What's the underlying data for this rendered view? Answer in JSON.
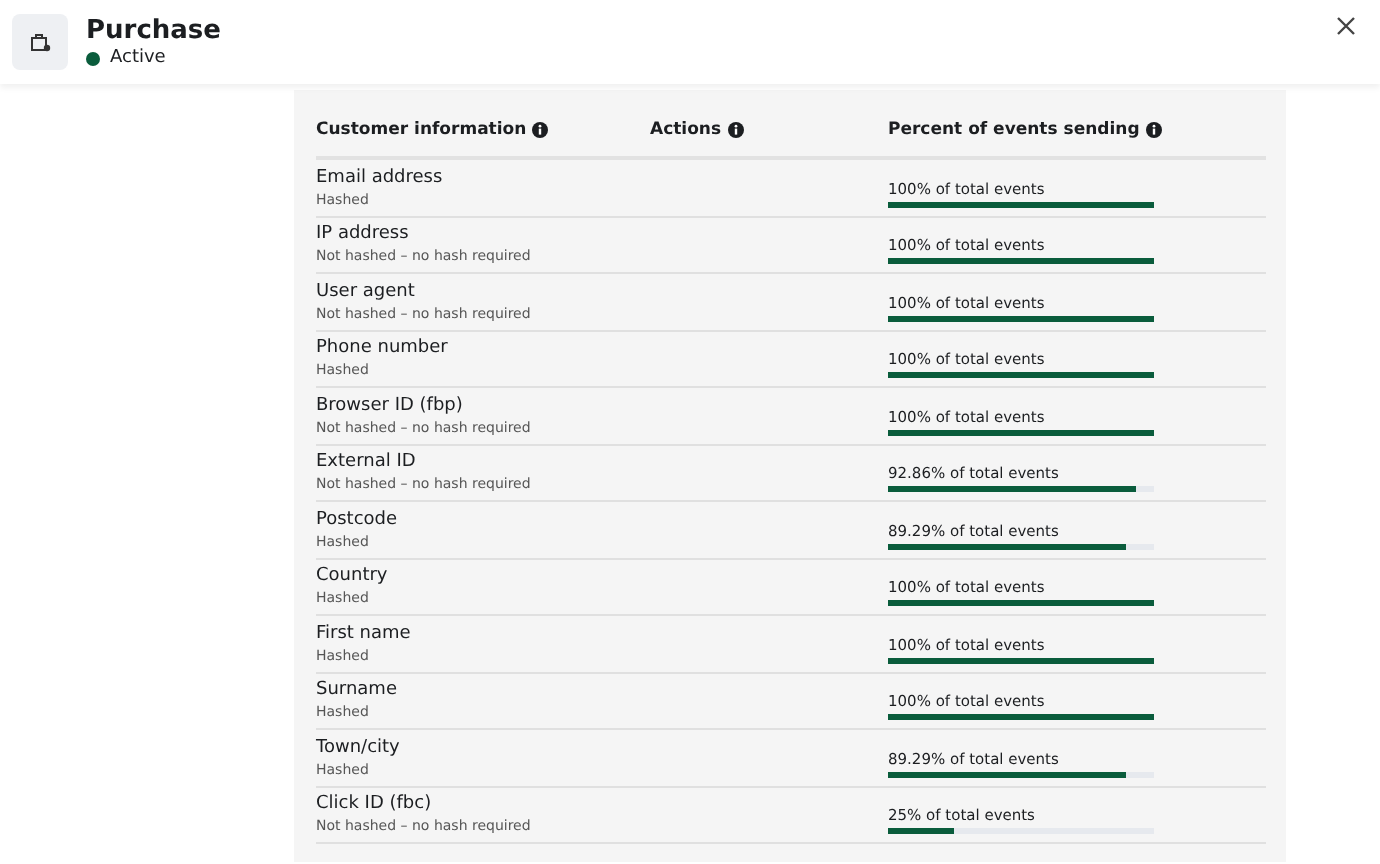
{
  "header": {
    "title": "Purchase",
    "status": {
      "label": "Active",
      "color": "#0a5c3c"
    }
  },
  "table": {
    "columns": [
      "Customer information",
      "Actions",
      "Percent of events sending"
    ],
    "rows": [
      {
        "name": "Email address",
        "hash": "Hashed",
        "percent": "100% of total events",
        "level": 1
      },
      {
        "name": "IP address",
        "hash": "Not hashed – no hash required",
        "percent": "100% of total events",
        "level": 1
      },
      {
        "name": "User agent",
        "hash": "Not hashed – no hash required",
        "percent": "100% of total events",
        "level": 1
      },
      {
        "name": "Phone number",
        "hash": "Hashed",
        "percent": "100% of total events",
        "level": 1
      },
      {
        "name": "Browser ID (fbp)",
        "hash": "Not hashed – no hash required",
        "percent": "100% of total events",
        "level": 1
      },
      {
        "name": "External ID",
        "hash": "Not hashed – no hash required",
        "percent": "92.86% of total events",
        "level": 0.9286
      },
      {
        "name": "Postcode",
        "hash": "Hashed",
        "percent": "89.29% of total events",
        "level": 0.8929
      },
      {
        "name": "Country",
        "hash": "Hashed",
        "percent": "100% of total events",
        "level": 1
      },
      {
        "name": "First name",
        "hash": "Hashed",
        "percent": "100% of total events",
        "level": 1
      },
      {
        "name": "Surname",
        "hash": "Hashed",
        "percent": "100% of total events",
        "level": 1
      },
      {
        "name": "Town/city",
        "hash": "Hashed",
        "percent": "89.29% of total events",
        "level": 0.8929
      },
      {
        "name": "Click ID (fbc)",
        "hash": "Not hashed – no hash required",
        "percent": "25% of total events",
        "level": 0.25
      }
    ]
  }
}
